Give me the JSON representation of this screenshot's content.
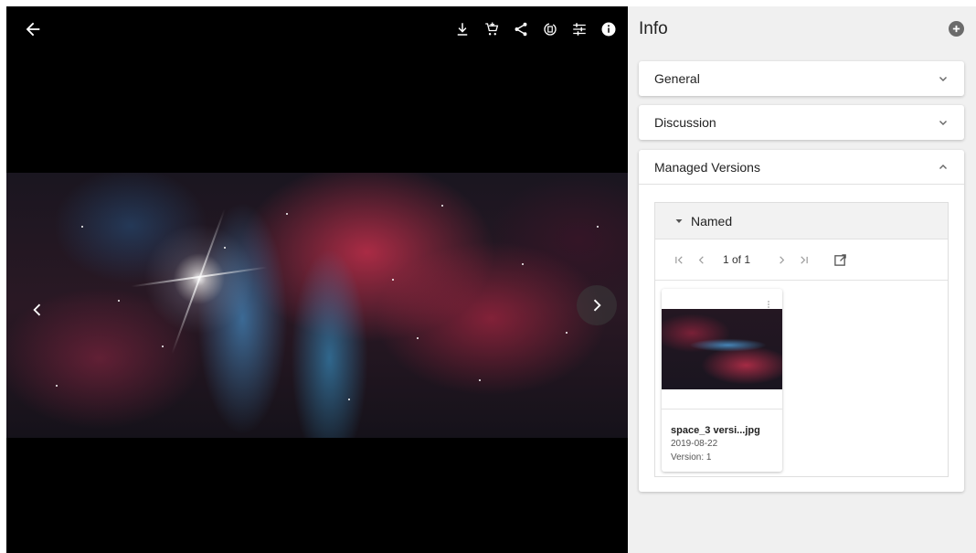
{
  "viewer": {
    "toolbar_icons": [
      "download-icon",
      "add-to-cart-icon",
      "share-icon",
      "convert-icon",
      "adjust-icon",
      "info-icon"
    ],
    "nav": [
      "chevron-left-icon",
      "chevron-right-icon"
    ]
  },
  "panel": {
    "title": "Info",
    "sections": {
      "general": "General",
      "discussion": "Discussion",
      "versions": "Managed Versions"
    },
    "named": {
      "label": "Named",
      "pager": {
        "count": "1 of 1"
      }
    },
    "asset": {
      "name": "space_3 versi...jpg",
      "date": "2019-08-22",
      "version": "Version: 1"
    }
  },
  "colors": {
    "viewer_bg": "#000000",
    "panel_bg": "#f0f0f0",
    "card_bg": "#ffffff",
    "text": "#222222"
  }
}
